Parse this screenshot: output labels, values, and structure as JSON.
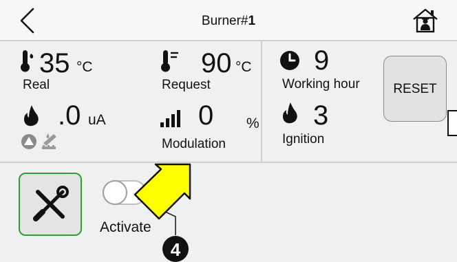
{
  "header": {
    "title_prefix": "Burner#",
    "title_num": "1"
  },
  "metrics": {
    "real": {
      "value": "35",
      "unit": "°C",
      "label": "Real"
    },
    "request": {
      "value": "90",
      "unit": "°C",
      "label": "Request"
    },
    "current": {
      "value": ".0",
      "unit": "uA"
    },
    "modulation": {
      "value": "0",
      "unit": "%",
      "label": "Modulation"
    },
    "working_hour": {
      "value": "9",
      "label": "Working hour"
    },
    "ignition": {
      "value": "3",
      "label": "Ignition"
    }
  },
  "reset_label": "RESET",
  "activate_label": "Activate",
  "toggle": {
    "state": "off"
  },
  "callout_number": "4",
  "colors": {
    "accent_green": "#2e9e3a",
    "arrow_yellow": "#ffff00",
    "panel_bg": "#f0f0f0",
    "toggle_off": "#bdbdbd"
  }
}
